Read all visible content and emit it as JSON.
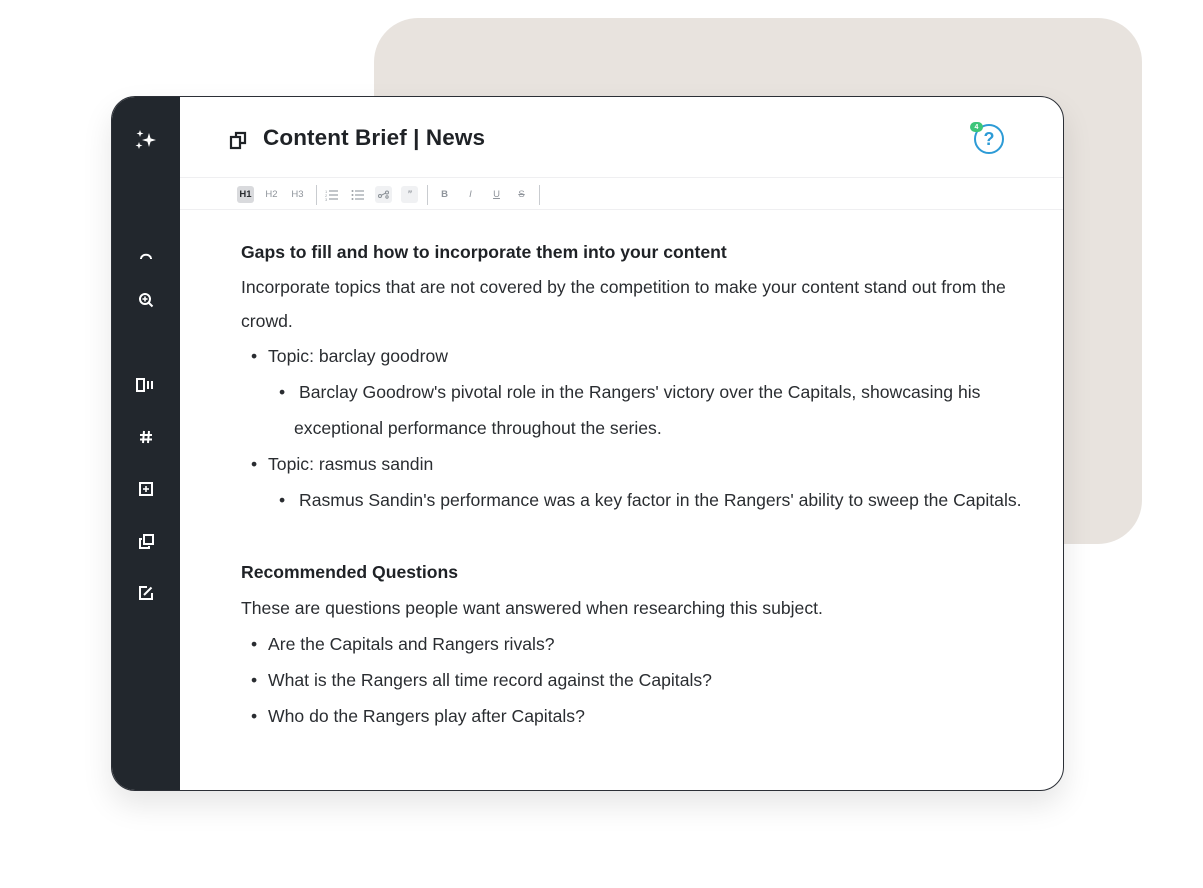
{
  "window": {
    "title": "Content Brief | News",
    "help_label": "?",
    "help_badge": "4"
  },
  "sidebar": {
    "items": [
      {
        "name": "sparkles-icon"
      },
      {
        "name": "gauge-icon"
      },
      {
        "name": "zoom-icon"
      },
      {
        "name": "columns-icon"
      },
      {
        "name": "hashtag-icon"
      },
      {
        "name": "add-box-icon"
      },
      {
        "name": "copy-icon"
      },
      {
        "name": "edit-icon"
      }
    ]
  },
  "toolbar": {
    "h1": "H1",
    "h2": "H2",
    "h3": "H3",
    "bold": "B",
    "italic": "I",
    "underline": "U",
    "strike": "S",
    "quote": "”",
    "icons": [
      "numbered-list-icon",
      "bullet-list-icon",
      "link-icon",
      "quote-icon"
    ]
  },
  "brief": {
    "gaps": {
      "heading": "Gaps to fill and how to incorporate them into your content",
      "intro": "Incorporate topics that are not covered by the competition to make your content stand out from the crowd.",
      "topics": [
        {
          "label": "Topic: barclay goodrow",
          "detail": "Barclay Goodrow's pivotal role in the Rangers' victory over the Capitals, showcasing his exceptional performance throughout the series."
        },
        {
          "label": "Topic: rasmus sandin",
          "detail": "Rasmus Sandin's performance was a key factor in the Rangers' ability to sweep the Capitals."
        }
      ]
    },
    "questions": {
      "heading": "Recommended Questions",
      "intro": "These are questions people want answered when researching this subject.",
      "items": [
        "Are the Capitals and Rangers rivals?",
        "What is the Rangers all time record against the Capitals?",
        "Who do the Rangers play after Capitals?"
      ]
    }
  },
  "colors": {
    "sidebar_bg": "#22272d",
    "backdrop": "#e8e3de",
    "help_accent": "#2d9bd6",
    "badge_green": "#3cc57a"
  }
}
